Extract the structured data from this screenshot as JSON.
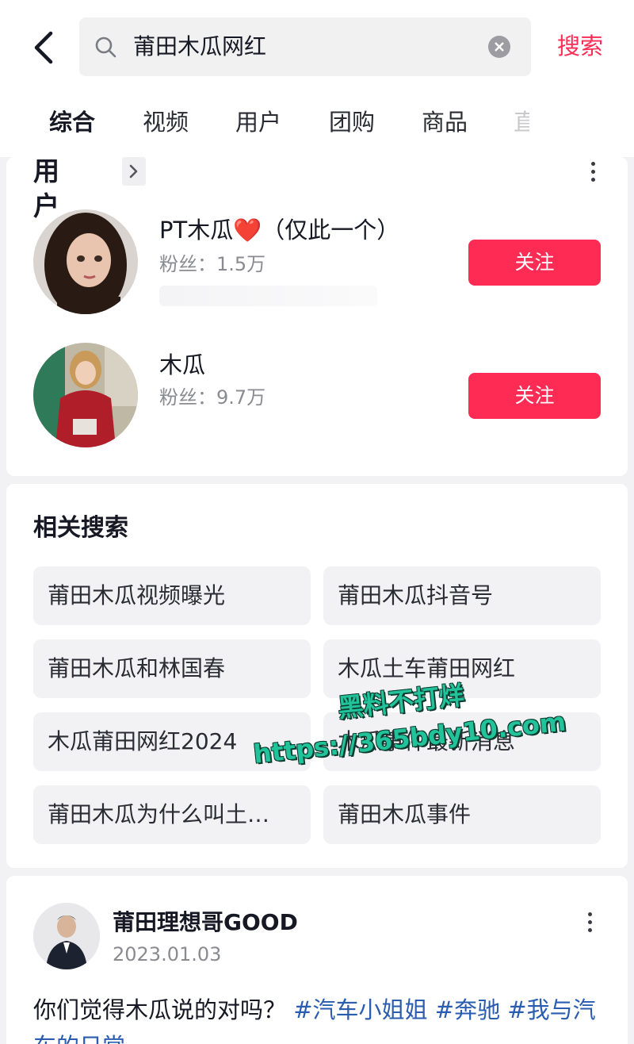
{
  "search": {
    "query": "莆田木瓜网红",
    "submit_label": "搜索"
  },
  "tabs": [
    "综合",
    "视频",
    "用户",
    "团购",
    "商品",
    "直"
  ],
  "users_section": {
    "title": "用户",
    "users": [
      {
        "name": "PT木瓜❤️（仅此一个）",
        "fans": "粉丝：1.5万",
        "follow_label": "关注"
      },
      {
        "name": "木瓜",
        "fans": "粉丝：9.7万",
        "follow_label": "关注"
      }
    ]
  },
  "related": {
    "title": "相关搜索",
    "items": [
      "莆田木瓜视频曝光",
      "莆田木瓜抖音号",
      "莆田木瓜和林国春",
      "木瓜土车莆田网红",
      "木瓜莆田网红2024",
      "木瓜事件最新消息",
      "莆田木瓜为什么叫土…",
      "莆田木瓜事件"
    ]
  },
  "post": {
    "author": "莆田理想哥GOOD",
    "date": "2023.01.03",
    "text": "你们觉得木瓜说的对吗？",
    "hashtags": [
      "#汽车小姐姐",
      "#奔驰",
      "#我与汽车的日常"
    ]
  },
  "watermark": {
    "line1": "黑料不打烊",
    "line2": "https://365bdy10.com"
  },
  "colors": {
    "accent": "#fe2c55",
    "hashtag": "#2a5db0",
    "watermark": "#22c39a"
  }
}
